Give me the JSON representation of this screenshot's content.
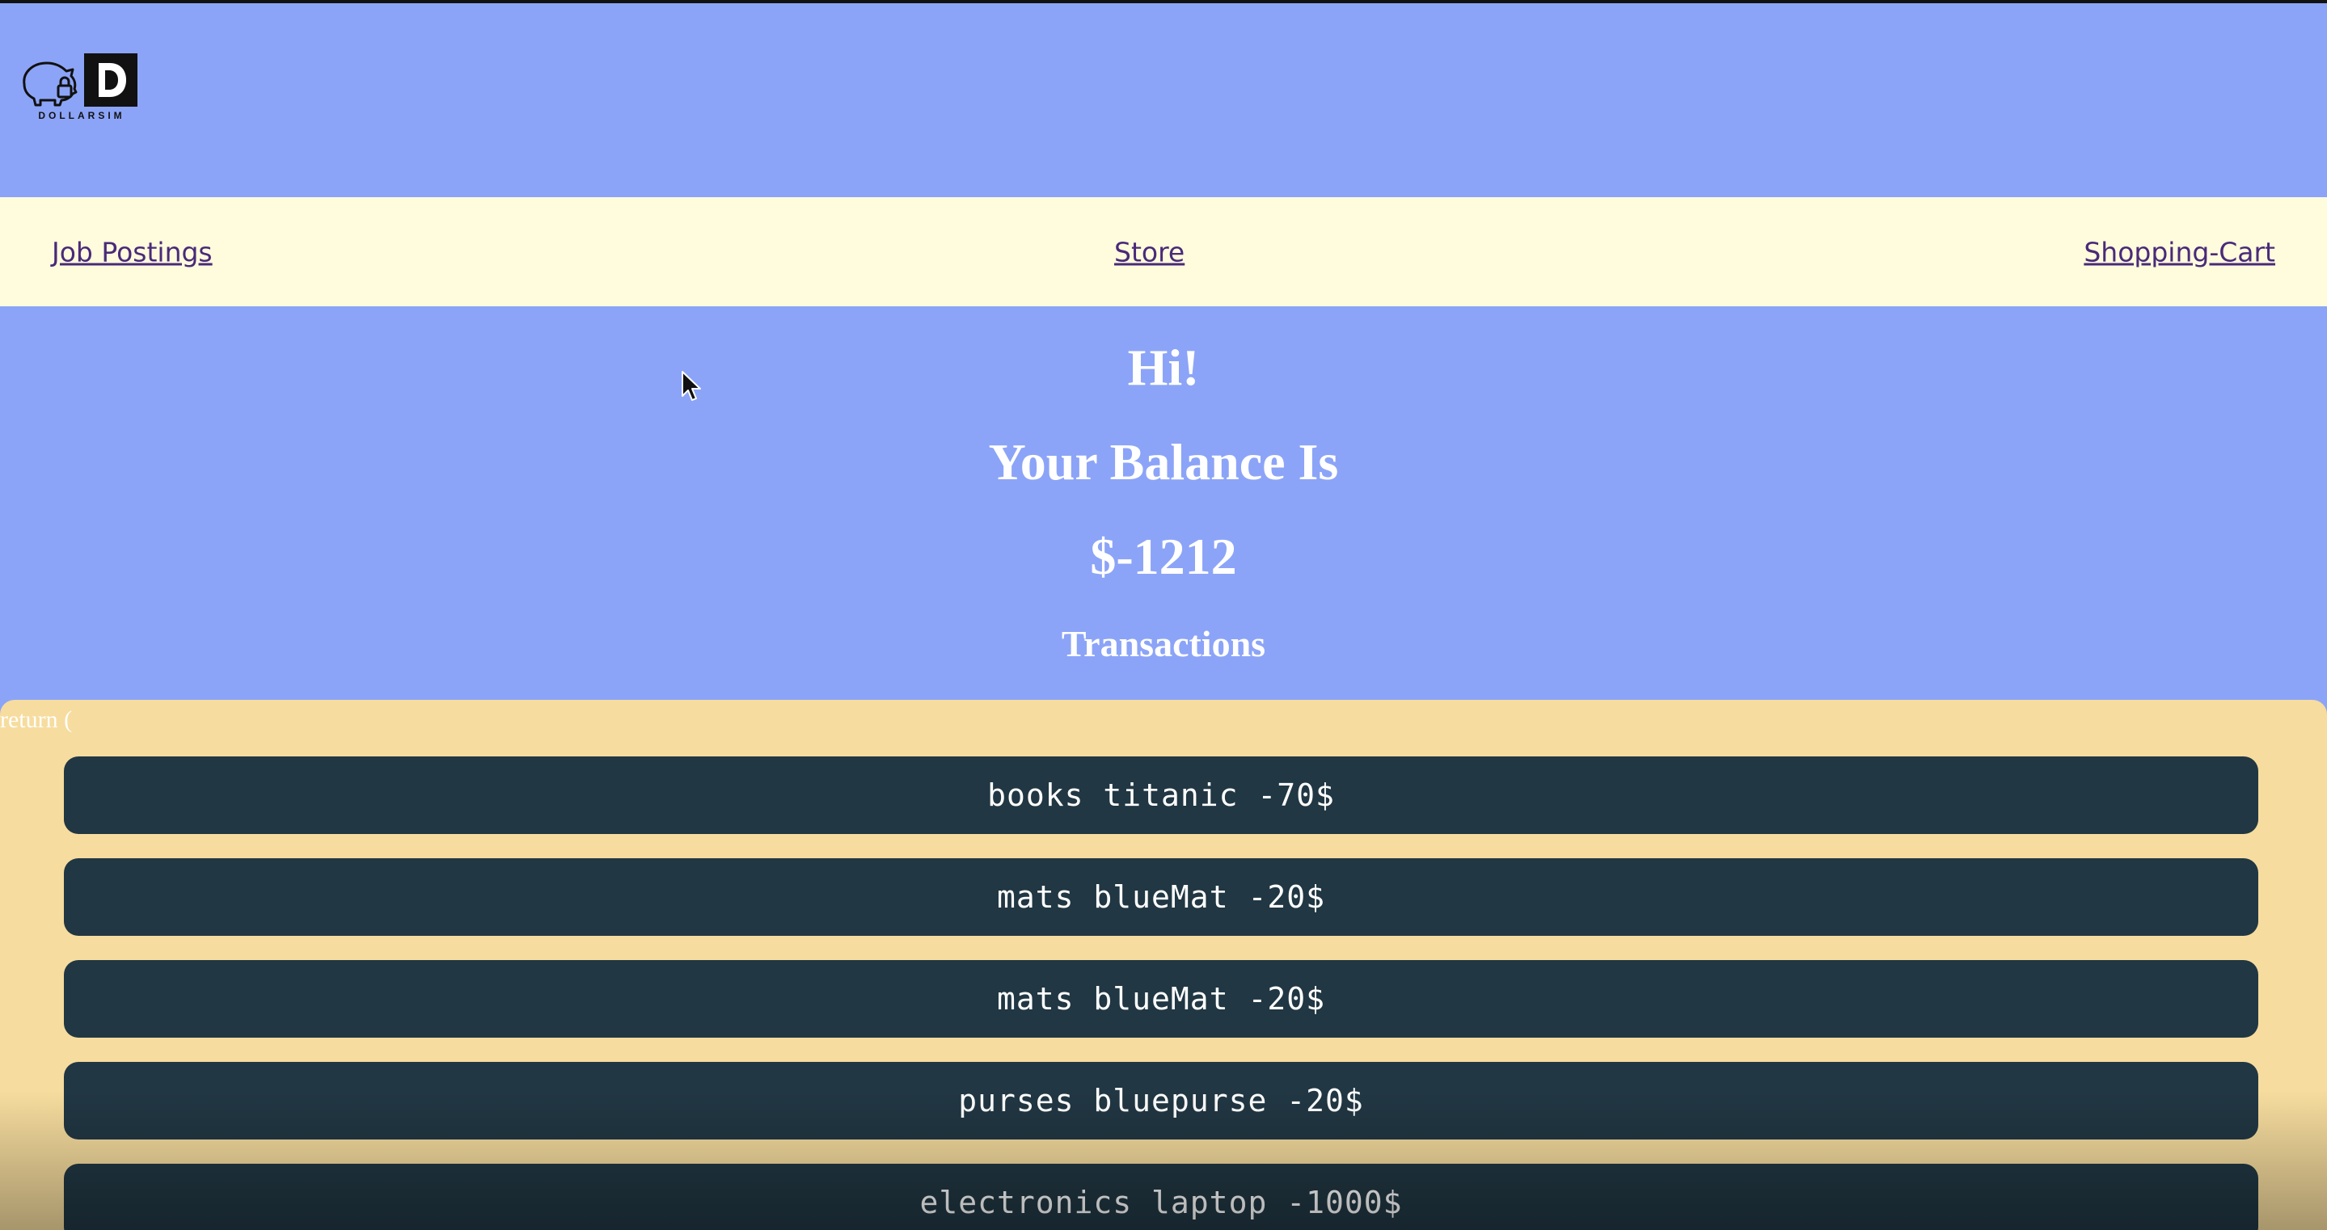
{
  "brand": {
    "logo_text": "DOLLARSIM",
    "logo_icon": "piggy-bank-lock-d-icon"
  },
  "nav": {
    "job_postings": "Job Postings",
    "store": "Store",
    "shopping_cart": "Shopping-Cart"
  },
  "main": {
    "greeting": "Hi!",
    "balance_label": "Your Balance Is",
    "balance_value": "$-1212",
    "transactions_title": "Transactions"
  },
  "transactions": {
    "code_fragment": "return (",
    "items": [
      "books titanic -70$",
      "mats blueMat -20$",
      "mats blueMat -20$",
      "purses bluepurse -20$",
      "electronics laptop -1000$"
    ]
  },
  "colors": {
    "header_bg": "#8ca4f7",
    "nav_bg": "#fefcdc",
    "panel_bg": "#f6dc9e",
    "item_bg": "#213743",
    "link": "#4a2a7a"
  }
}
